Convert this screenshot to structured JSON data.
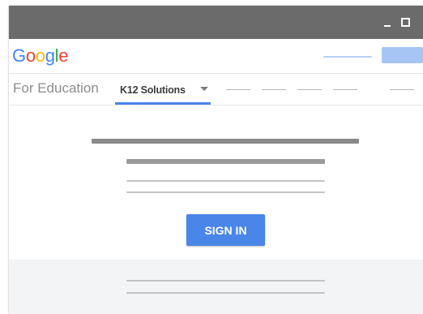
{
  "app": {
    "logo_text": "Google"
  },
  "nav": {
    "brand_label": "For Education",
    "active_tab_label": "K12 Solutions"
  },
  "main": {
    "signin_label": "SIGN IN"
  },
  "icons": {
    "dropdown": "caret-down-icon",
    "minimize": "minimize-icon",
    "maximize": "maximize-icon"
  },
  "colors": {
    "titlebar": "#6b6b6b",
    "accent_blue": "#4a86e8",
    "logo": [
      "#4285f4",
      "#ea4335",
      "#fbbc05",
      "#4285f4",
      "#34a853",
      "#ea4335"
    ]
  }
}
